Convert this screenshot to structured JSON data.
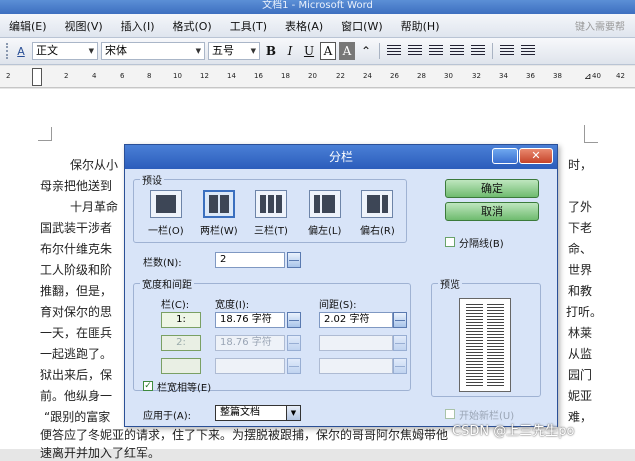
{
  "window": {
    "title": "文档1 - Microsoft Word"
  },
  "menu": {
    "items": [
      "编辑(E)",
      "视图(V)",
      "插入(I)",
      "格式(O)",
      "工具(T)",
      "表格(A)",
      "窗口(W)",
      "帮助(H)"
    ],
    "help_box": "键入需要帮"
  },
  "toolbar": {
    "style": "正文",
    "font": "宋体",
    "size": "五号",
    "bold_label": "B",
    "italic_label": "I",
    "underline_label": "U",
    "font_color_label": "A",
    "char_shading_label": "A"
  },
  "ruler": {
    "ticks": [
      "2",
      "2",
      "4",
      "6",
      "8",
      "10",
      "12",
      "14",
      "16",
      "18",
      "20",
      "22",
      "24",
      "26",
      "28",
      "30",
      "32",
      "34",
      "36",
      "38",
      "40",
      "42"
    ]
  },
  "document": {
    "lines_left": [
      "保尔从小",
      "母亲把他送到",
      "十月革命",
      "国武装干涉者",
      "布尔什维克朱",
      "工人阶级和阶",
      "推翻，但是，",
      "育对保尔的思",
      "一天，在匪兵",
      "一起逃跑了。",
      "狱出来后，保",
      "前。他纵身一",
      "“跟别的富家",
      "便答应了冬妮亚的请求，住了下来。为摆脱被跟捕，保尔的哥哥阿尔焦姆带他",
      "速离开并加入了红军。"
    ],
    "lines_right": [
      "时，",
      "了外",
      "下老",
      "命、",
      "世界",
      "和教",
      "打听。",
      "林莱",
      "从监",
      "园门",
      "妮亚",
      "难，"
    ]
  },
  "dialog": {
    "title": "分栏",
    "presets_label": "预设",
    "presets": [
      {
        "label": "一栏(O)"
      },
      {
        "label": "两栏(W)"
      },
      {
        "label": "三栏(T)"
      },
      {
        "label": "偏左(L)"
      },
      {
        "label": "偏右(R)"
      }
    ],
    "ok_label": "确定",
    "cancel_label": "取消",
    "divider_label": "分隔线(B)",
    "columns_count_label": "栏数(N):",
    "columns_count_value": "2",
    "width_spacing_label": "宽度和间距",
    "col_header": "栏(C):",
    "width_header": "宽度(I):",
    "spacing_header": "间距(S):",
    "rows": [
      {
        "num": "1:",
        "width": "18.76 字符",
        "spacing": "2.02 字符"
      },
      {
        "num": "2:",
        "width": "18.76 字符",
        "spacing": ""
      }
    ],
    "equal_width_label": "栏宽相等(E)",
    "apply_to_label": "应用于(A):",
    "apply_to_value": "整篇文档",
    "preview_label": "预览",
    "new_column_label": "开始新栏(U)"
  },
  "watermark": "CSDN @上三先生po",
  "colors": {
    "dialog_title": "#2b5dbb",
    "button_green": "#6fbb6f",
    "dialog_bg": "#d8e4f8"
  }
}
